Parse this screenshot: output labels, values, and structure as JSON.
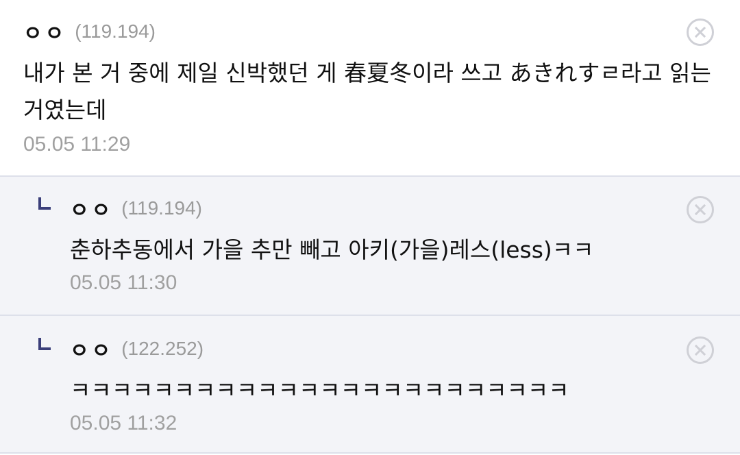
{
  "comments": [
    {
      "nick": "ㅇㅇ",
      "ip": "(119.194)",
      "text": "내가 본 거 중에 제일 신박했던 게 春夏冬이라 쓰고 あきれすㄹ라고 읽는 거였는데",
      "date": "05.05 11:29"
    },
    {
      "nick": "ㅇㅇ",
      "ip": "(119.194)",
      "text": "춘하추동에서 가을 추만 빼고 아키(가을)레스(less)ㅋㅋ",
      "date": "05.05 11:30"
    },
    {
      "nick": "ㅇㅇ",
      "ip": "(122.252)",
      "text": "ㅋㅋㅋㅋㅋㅋㅋㅋㅋㅋㅋㅋㅋㅋㅋㅋㅋㅋㅋㅋㅋㅋㅋㅋ",
      "date": "05.05 11:32"
    }
  ],
  "icons": {
    "delete": "close-circle-icon",
    "reply": "reply-arrow-icon"
  },
  "colors": {
    "reply_bg": "#f3f4f8",
    "divider": "#dde0ea",
    "muted_text": "#9a9a9a",
    "reply_icon": "#3b3f7a"
  }
}
